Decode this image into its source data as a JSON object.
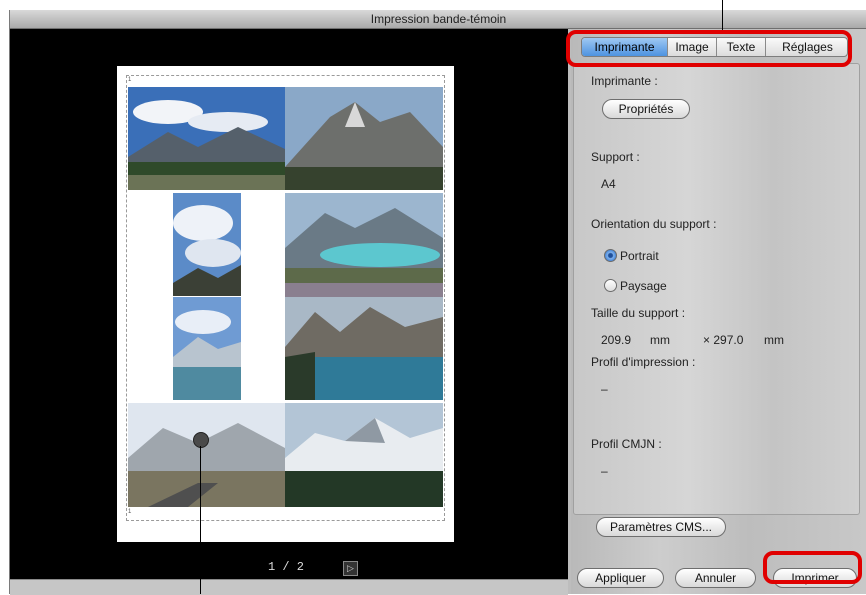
{
  "window": {
    "title": "Impression bande-témoin"
  },
  "tabs": [
    {
      "label": "Imprimante",
      "active": true
    },
    {
      "label": "Image",
      "active": false
    },
    {
      "label": "Texte",
      "active": false
    },
    {
      "label": "Réglages",
      "active": false
    }
  ],
  "panel": {
    "printer_label": "Imprimante :",
    "properties_button": "Propriétés",
    "support_label": "Support :",
    "support_value": "A4",
    "orientation_label": "Orientation du support :",
    "orientation_options": [
      {
        "label": "Portrait",
        "selected": true
      },
      {
        "label": "Paysage",
        "selected": false
      }
    ],
    "size_label": "Taille du support :",
    "size_width": "209.9",
    "size_width_unit": "mm",
    "size_height": "× 297.0",
    "size_height_unit": "mm",
    "print_profile_label": "Profil d'impression :",
    "print_profile_value": "–",
    "cmyk_profile_label": "Profil CMJN :",
    "cmyk_profile_value": "–",
    "cms_button": "Paramètres CMS..."
  },
  "actions": {
    "apply": "Appliquer",
    "cancel": "Annuler",
    "print": "Imprimer"
  },
  "preview": {
    "page_indicator": "1 / 2",
    "corner_marks": [
      "1",
      "1"
    ],
    "photos": [
      {
        "name": "photo-mountain-meadow",
        "subject": "mountains with clouds over a grassy valley"
      },
      {
        "name": "photo-rocky-peak",
        "subject": "rocky mountain peak"
      },
      {
        "name": "photo-clouds-vertical",
        "subject": "clouds above mountains"
      },
      {
        "name": "photo-turquoise-lake",
        "subject": "turquoise lake in mountains"
      },
      {
        "name": "photo-lake-vertical",
        "subject": "mountain lake reflection"
      },
      {
        "name": "photo-moraine-lake",
        "subject": "mountain lake with peaks"
      },
      {
        "name": "photo-glacier-road",
        "subject": "glacier and road"
      },
      {
        "name": "photo-snowy-peaks",
        "subject": "snowy peaks and forest"
      }
    ]
  },
  "colors": {
    "highlight": "#e00000",
    "tab_active": "#4e93e0"
  }
}
